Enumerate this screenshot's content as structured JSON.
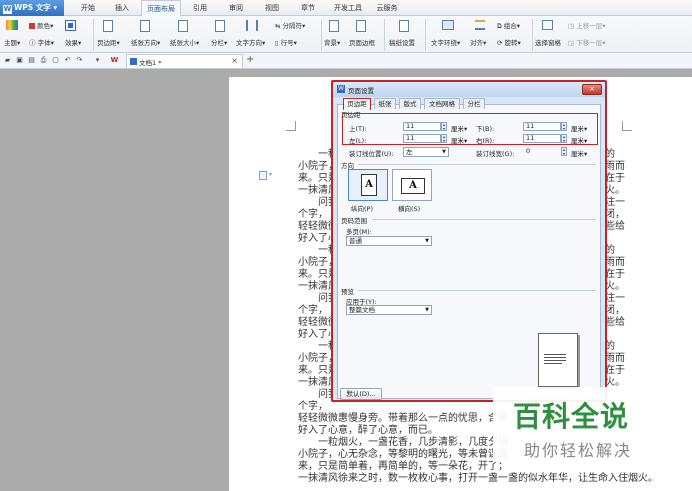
{
  "app": {
    "name": "WPS 文字"
  },
  "menu": {
    "tabs": [
      "开始",
      "插入",
      "页面布局",
      "引用",
      "审阅",
      "视图",
      "章节",
      "开发工具",
      "云服务"
    ],
    "active_tab": "页面布局"
  },
  "ribbon": {
    "theme": "主题",
    "color": "颜色",
    "font": "字体",
    "effect": "效果",
    "margins": "页边距",
    "orientation": "纸张方向",
    "size": "纸张大小",
    "columns": "分栏",
    "text_direction": "文字方向",
    "line_number": "行号",
    "separator": "分隔符",
    "background": "背景",
    "page_border": "页面边框",
    "draft_grid": "稿纸设置",
    "wrap": "文字环绕",
    "align": "对齐",
    "group": "组合",
    "rotate": "旋转",
    "selection_pane": "选择窗格",
    "bring_forward": "上移一层",
    "send_backward": "下移一层"
  },
  "document_tab": {
    "title": "文档1 *",
    "close": "×",
    "add": "+"
  },
  "doc_text": {
    "left_lines": [
      "一秒",
      "小院子，",
      "来。只是",
      "一抹清风",
      "问我",
      "个字，",
      "轻轻微微",
      "好入了心",
      "一秒",
      "小院子，",
      "来。只是",
      "一抹清风",
      "问我",
      "个字，",
      "轻轻微微",
      "好入了心",
      "一秒",
      "小院子，",
      "来。只是",
      "一抹清风",
      "问我",
      "个字，"
    ],
    "right_lines": [
      "的",
      "雨而",
      "在于",
      "火。",
      "注一",
      "闭，",
      "些给",
      "",
      "的",
      "雨而",
      "在于",
      "火。",
      "注一",
      "闭，",
      "些给",
      "",
      "的",
      "雨而",
      "在于",
      "火。"
    ],
    "bottom_lines": [
      "轻轻微微惠慢身旁。带着那么一点的忧思，含着",
      "好入了心意，醉了心意，而已。",
      "一粒烟火，一盏花香，几步清影，几度夕阳",
      "小院子，心无杂念，等黎明的曙光，等未曾谋面",
      "来，只是简单着，再简单的，等一朵花，开了；",
      "一抹清风徐来之时，数一枚枚心事，打开一盏一盏的似水年华，让生命入住烟火。"
    ]
  },
  "dialog": {
    "title": "页面设置",
    "close": "×",
    "tabs": [
      "页边距",
      "纸张",
      "版式",
      "文档网格",
      "分栏"
    ],
    "active_tab": "页边距",
    "margins_group": "页边距",
    "top_label": "上(T):",
    "top_value": "11",
    "bottom_label": "下(B):",
    "bottom_value": "11",
    "left_label": "左(L):",
    "left_value": "11",
    "right_label": "右(R):",
    "right_value": "11",
    "unit": "厘米",
    "gutter_pos_label": "装订线位置(U):",
    "gutter_pos_value": "左",
    "gutter_width_label": "装订线宽(G):",
    "gutter_width_value": "0",
    "orientation_group": "方向",
    "portrait": "纵向(P)",
    "landscape": "横向(S)",
    "page_range_group": "页码范围",
    "multiple_pages_label": "多页(M):",
    "multiple_pages_value": "普通",
    "preview_group": "预览",
    "apply_to_label": "应用于(Y):",
    "apply_to_value": "整篇文档",
    "default_button": "默认(D)..."
  },
  "watermark": {
    "title": "百科全说",
    "subtitle": "助你轻松解决"
  },
  "colors": {
    "highlight": "#ca2128",
    "accent": "#2f6fbf",
    "watermark": "#2e8f3e"
  }
}
